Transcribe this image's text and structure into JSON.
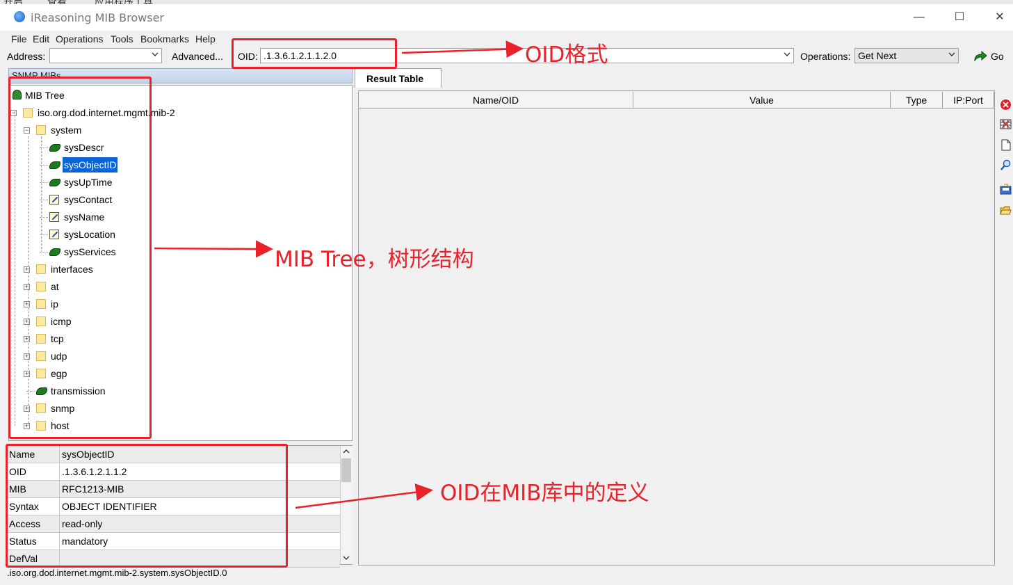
{
  "background_window": {
    "items": [
      "开启",
      "查看",
      "应用程序工具"
    ]
  },
  "window": {
    "title": "iReasoning MIB Browser",
    "minimize": "—",
    "maximize": "☐",
    "close": "✕"
  },
  "menu": [
    "File",
    "Edit",
    "Operations",
    "Tools",
    "Bookmarks",
    "Help"
  ],
  "toolbar": {
    "address_label": "Address:",
    "address_value": "",
    "advanced_label": "Advanced...",
    "oid_label": "OID:",
    "oid_value": ".1.3.6.1.2.1.1.2.0",
    "operations_label": "Operations:",
    "operations_value": "Get Next",
    "go_label": "Go"
  },
  "left_panel": {
    "header": "SNMP MIBs",
    "tree": [
      {
        "label": "MIB Tree",
        "icon": "tree-icon",
        "level": 0
      },
      {
        "label": "iso.org.dod.internet.mgmt.mib-2",
        "icon": "folder-icon",
        "level": 1,
        "expander": "-"
      },
      {
        "label": "system",
        "icon": "folder-icon",
        "level": 2,
        "expander": "-"
      },
      {
        "label": "sysDescr",
        "icon": "leaf-icon",
        "level": 3
      },
      {
        "label": "sysObjectID",
        "icon": "leaf-icon",
        "level": 3,
        "selected": true
      },
      {
        "label": "sysUpTime",
        "icon": "leaf-icon",
        "level": 3
      },
      {
        "label": "sysContact",
        "icon": "edit-icon",
        "level": 3
      },
      {
        "label": "sysName",
        "icon": "edit-icon",
        "level": 3
      },
      {
        "label": "sysLocation",
        "icon": "edit-icon",
        "level": 3
      },
      {
        "label": "sysServices",
        "icon": "leaf-icon",
        "level": 3
      },
      {
        "label": "interfaces",
        "icon": "folder-icon",
        "level": 2,
        "expander": "+"
      },
      {
        "label": "at",
        "icon": "folder-icon",
        "level": 2,
        "expander": "+"
      },
      {
        "label": "ip",
        "icon": "folder-icon",
        "level": 2,
        "expander": "+"
      },
      {
        "label": "icmp",
        "icon": "folder-icon",
        "level": 2,
        "expander": "+"
      },
      {
        "label": "tcp",
        "icon": "folder-icon",
        "level": 2,
        "expander": "+"
      },
      {
        "label": "udp",
        "icon": "folder-icon",
        "level": 2,
        "expander": "+"
      },
      {
        "label": "egp",
        "icon": "folder-icon",
        "level": 2,
        "expander": "+"
      },
      {
        "label": "transmission",
        "icon": "leaf-icon",
        "level": 2
      },
      {
        "label": "snmp",
        "icon": "folder-icon",
        "level": 2,
        "expander": "+"
      },
      {
        "label": "host",
        "icon": "folder-icon",
        "level": 2,
        "expander": "+"
      }
    ],
    "properties": [
      {
        "key": "Name",
        "value": "sysObjectID"
      },
      {
        "key": "OID",
        "value": ".1.3.6.1.2.1.1.2"
      },
      {
        "key": "MIB",
        "value": "RFC1213-MIB"
      },
      {
        "key": "Syntax",
        "value": "OBJECT IDENTIFIER"
      },
      {
        "key": "Access",
        "value": "read-only"
      },
      {
        "key": "Status",
        "value": "mandatory"
      },
      {
        "key": "DefVal",
        "value": ""
      }
    ]
  },
  "status_bar": ".iso.org.dod.internet.mgmt.mib-2.system.sysObjectID.0",
  "result": {
    "tab": "Result Table",
    "columns": [
      "Name/OID",
      "Value",
      "Type",
      "IP:Port"
    ]
  },
  "side_tools": [
    "delete-icon",
    "table-icon",
    "new-document-icon",
    "find-icon",
    "save-icon",
    "open-folder-icon"
  ],
  "annotations": {
    "oid_format": "OID格式",
    "mib_tree": "MIB Tree，树形结构",
    "oid_definition": "OID在MIB库中的定义",
    "color": "#e8212b"
  }
}
